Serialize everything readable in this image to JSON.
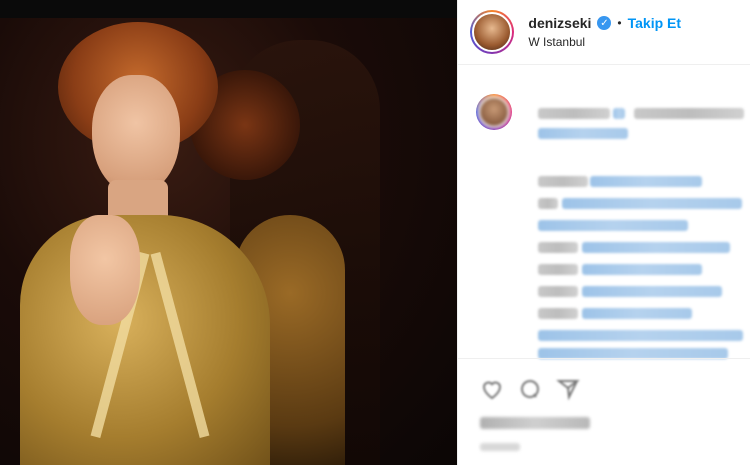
{
  "post": {
    "username": "denizseki",
    "verified_icon": "verified-badge-icon",
    "separator": "•",
    "follow_label": "Takip Et",
    "location": "W Istanbul"
  },
  "colors": {
    "follow_blue": "#0095f6",
    "verified_blue": "#3897f0",
    "text": "#262626",
    "border": "#efefef"
  },
  "icons": [
    "heart-icon",
    "comment-icon",
    "share-icon"
  ]
}
